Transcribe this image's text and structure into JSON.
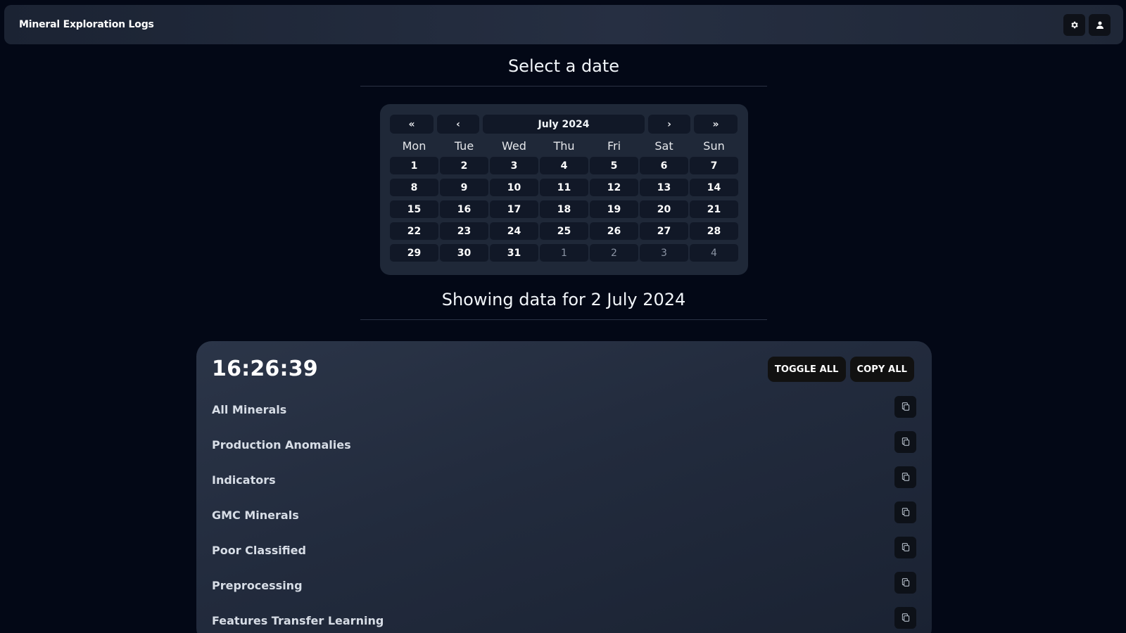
{
  "header": {
    "title": "Mineral Exploration Logs",
    "icons": [
      "gear-icon",
      "user-icon"
    ]
  },
  "calendar_section": {
    "title": "Select a date",
    "nav": {
      "first": "«",
      "prev": "‹",
      "month": "July 2024",
      "next": "›",
      "last": "»"
    },
    "weekdays": [
      "Mon",
      "Tue",
      "Wed",
      "Thu",
      "Fri",
      "Sat",
      "Sun"
    ],
    "days": [
      {
        "label": "1",
        "current": true
      },
      {
        "label": "2",
        "current": true
      },
      {
        "label": "3",
        "current": true
      },
      {
        "label": "4",
        "current": true
      },
      {
        "label": "5",
        "current": true
      },
      {
        "label": "6",
        "current": true
      },
      {
        "label": "7",
        "current": true
      },
      {
        "label": "8",
        "current": true
      },
      {
        "label": "9",
        "current": true
      },
      {
        "label": "10",
        "current": true
      },
      {
        "label": "11",
        "current": true
      },
      {
        "label": "12",
        "current": true
      },
      {
        "label": "13",
        "current": true
      },
      {
        "label": "14",
        "current": true
      },
      {
        "label": "15",
        "current": true
      },
      {
        "label": "16",
        "current": true
      },
      {
        "label": "17",
        "current": true
      },
      {
        "label": "18",
        "current": true
      },
      {
        "label": "19",
        "current": true
      },
      {
        "label": "20",
        "current": true
      },
      {
        "label": "21",
        "current": true
      },
      {
        "label": "22",
        "current": true
      },
      {
        "label": "23",
        "current": true
      },
      {
        "label": "24",
        "current": true
      },
      {
        "label": "25",
        "current": true
      },
      {
        "label": "26",
        "current": true
      },
      {
        "label": "27",
        "current": true
      },
      {
        "label": "28",
        "current": true
      },
      {
        "label": "29",
        "current": true
      },
      {
        "label": "30",
        "current": true
      },
      {
        "label": "31",
        "current": true
      },
      {
        "label": "1",
        "current": false
      },
      {
        "label": "2",
        "current": false
      },
      {
        "label": "3",
        "current": false
      },
      {
        "label": "4",
        "current": false
      }
    ]
  },
  "data_section": {
    "title": "Showing data for 2 July 2024",
    "time": "16:26:39",
    "toggle_all": "TOGGLE ALL",
    "copy_all": "COPY ALL",
    "rows": [
      {
        "label": "All Minerals"
      },
      {
        "label": "Production Anomalies"
      },
      {
        "label": "Indicators"
      },
      {
        "label": "GMC Minerals"
      },
      {
        "label": "Poor Classified"
      },
      {
        "label": "Preprocessing"
      },
      {
        "label": "Features Transfer Learning"
      }
    ]
  },
  "colors": {
    "background": "#030816",
    "surface": "#1f2838",
    "button": "#111827"
  }
}
